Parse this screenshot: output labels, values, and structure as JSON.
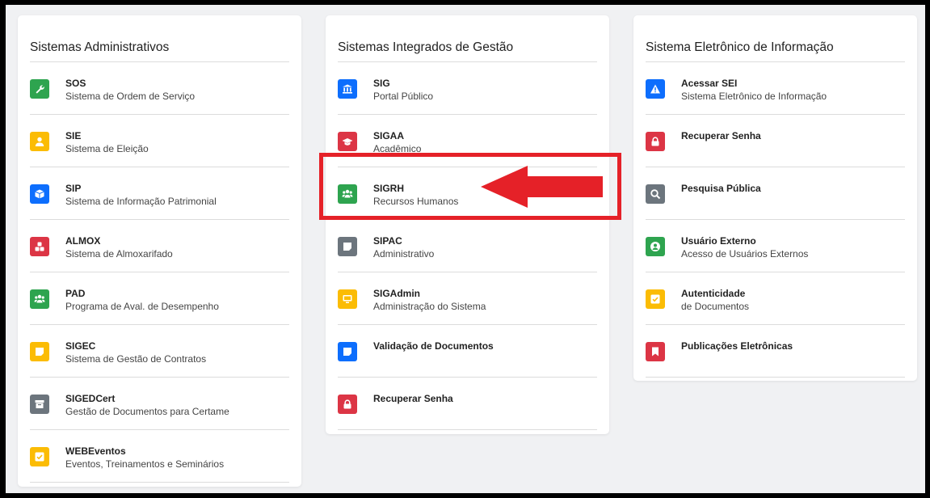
{
  "colors": {
    "green": "#2ea44f",
    "yellow": "#fbbc05",
    "blue": "#0d6efd",
    "red": "#dc3545",
    "gray": "#6c757d",
    "annotation_red": "#e52128"
  },
  "columns": [
    {
      "title": "Sistemas Administrativos",
      "items": [
        {
          "title": "SOS",
          "subtitle": "Sistema de Ordem de Serviço",
          "color": "green",
          "icon": "wrench-icon"
        },
        {
          "title": "SIE",
          "subtitle": "Sistema de Eleição",
          "color": "yellow",
          "icon": "user-icon"
        },
        {
          "title": "SIP",
          "subtitle": "Sistema de Informação Patrimonial",
          "color": "blue",
          "icon": "box-icon"
        },
        {
          "title": "ALMOX",
          "subtitle": "Sistema de Almoxarifado",
          "color": "red",
          "icon": "boxes-icon"
        },
        {
          "title": "PAD",
          "subtitle": "Programa de Aval. de Desempenho",
          "color": "green",
          "icon": "users-icon"
        },
        {
          "title": "SIGEC",
          "subtitle": "Sistema de Gestão de Contratos",
          "color": "yellow",
          "icon": "note-icon"
        },
        {
          "title": "SIGEDCert",
          "subtitle": "Gestão de Documentos para Certame",
          "color": "gray",
          "icon": "archive-icon"
        },
        {
          "title": "WEBEventos",
          "subtitle": "Eventos, Treinamentos e Seminários",
          "color": "yellow",
          "icon": "check-square-icon"
        }
      ]
    },
    {
      "title": "Sistemas Integrados de Gestão",
      "items": [
        {
          "title": "SIG",
          "subtitle": "Portal Público",
          "color": "blue",
          "icon": "landmark-icon"
        },
        {
          "title": "SIGAA",
          "subtitle": "Acadêmico",
          "color": "red",
          "icon": "graduation-cap-icon"
        },
        {
          "title": "SIGRH",
          "subtitle": "Recursos Humanos",
          "color": "green",
          "icon": "users-icon"
        },
        {
          "title": "SIPAC",
          "subtitle": "Administrativo",
          "color": "gray",
          "icon": "note-icon"
        },
        {
          "title": "SIGAdmin",
          "subtitle": "Administração do Sistema",
          "color": "yellow",
          "icon": "desktop-icon"
        },
        {
          "title": "Validação de Documentos",
          "subtitle": "",
          "color": "blue",
          "icon": "note-icon"
        },
        {
          "title": "Recuperar Senha",
          "subtitle": "",
          "color": "red",
          "icon": "lock-icon"
        }
      ]
    },
    {
      "title": "Sistema Eletrônico de Informação",
      "items": [
        {
          "title": "Acessar SEI",
          "subtitle": "Sistema Eletrônico de Informação",
          "color": "blue",
          "icon": "warning-icon"
        },
        {
          "title": "Recuperar Senha",
          "subtitle": "",
          "color": "red",
          "icon": "lock-icon"
        },
        {
          "title": "Pesquisa Pública",
          "subtitle": "",
          "color": "gray",
          "icon": "search-icon"
        },
        {
          "title": "Usuário Externo",
          "subtitle": "Acesso de Usuários Externos",
          "color": "green",
          "icon": "user-circle-icon"
        },
        {
          "title": "Autenticidade",
          "subtitle": "de Documentos",
          "color": "yellow",
          "icon": "check-square-icon"
        },
        {
          "title": "Publicações Eletrônicas",
          "subtitle": "",
          "color": "red",
          "icon": "bookmark-icon"
        }
      ]
    }
  ]
}
